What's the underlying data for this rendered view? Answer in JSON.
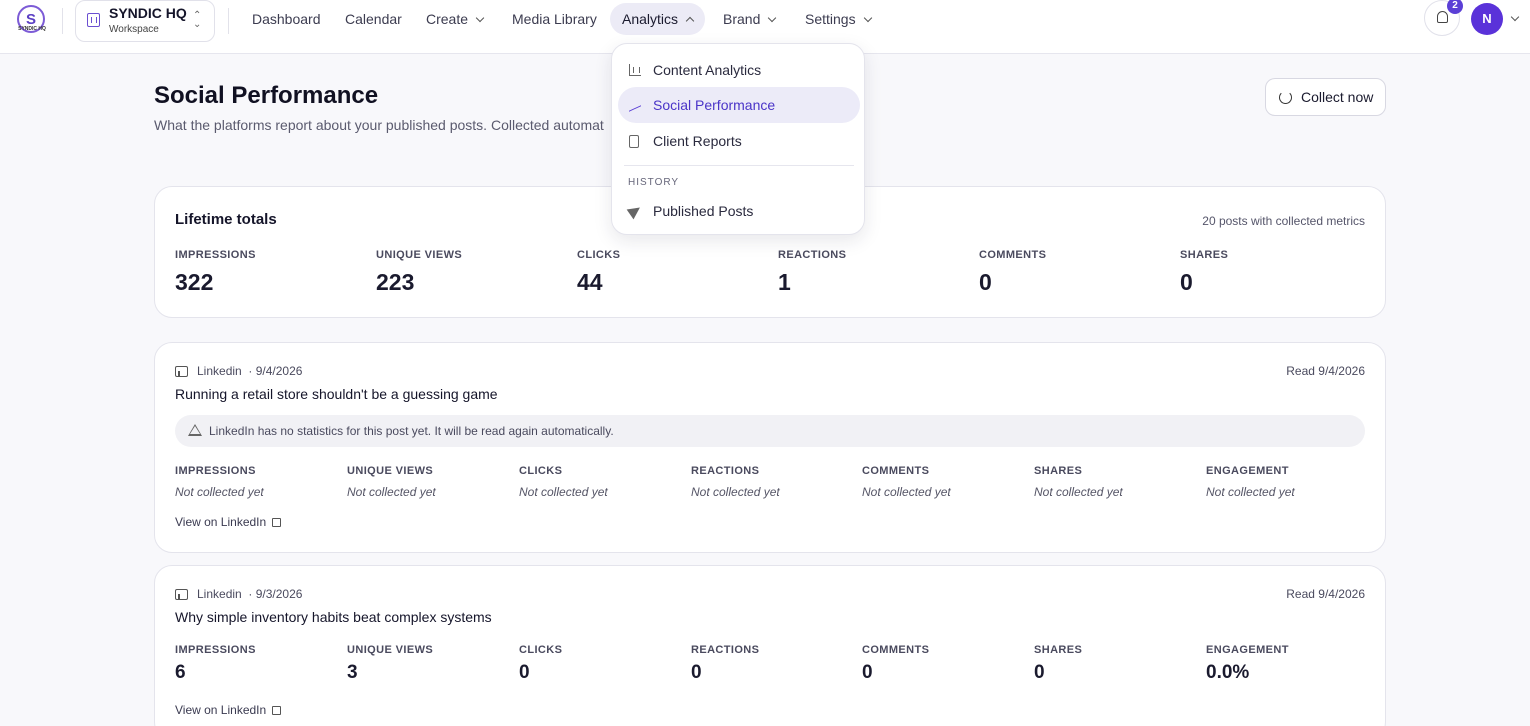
{
  "logo": {
    "mark": "S",
    "text": "SYNDIC HQ"
  },
  "workspace": {
    "name": "SYNDIC HQ",
    "sub": "Workspace"
  },
  "nav": {
    "dashboard": "Dashboard",
    "calendar": "Calendar",
    "create": "Create",
    "media": "Media Library",
    "analytics": "Analytics",
    "brand": "Brand",
    "settings": "Settings"
  },
  "notifications": {
    "count": "2"
  },
  "user": {
    "initial": "N"
  },
  "page": {
    "title": "Social Performance",
    "subtitle": "What the platforms report about your published posts. Collected automat",
    "collect_label": "Collect now"
  },
  "analytics_menu": {
    "items": [
      "Content Analytics",
      "Social Performance",
      "Client Reports"
    ],
    "section": "HISTORY",
    "history_items": [
      "Published Posts"
    ]
  },
  "totals": {
    "title": "Lifetime totals",
    "meta": "20 posts with collected metrics",
    "metrics": [
      {
        "label": "Impressions",
        "value": "322"
      },
      {
        "label": "Unique views",
        "value": "223"
      },
      {
        "label": "Clicks",
        "value": "44"
      },
      {
        "label": "Reactions",
        "value": "1"
      },
      {
        "label": "Comments",
        "value": "0"
      },
      {
        "label": "Shares",
        "value": "0"
      }
    ]
  },
  "posts": [
    {
      "platform": "Linkedin",
      "date": "· 9/4/2026",
      "read": "Read 9/4/2026",
      "title": "Running a retail store shouldn't be a guessing game",
      "warning": "LinkedIn has no statistics for this post yet. It will be read again automatically.",
      "link": "View on LinkedIn",
      "metrics": [
        {
          "label": "Impressions",
          "value": "Not collected yet"
        },
        {
          "label": "Unique views",
          "value": "Not collected yet"
        },
        {
          "label": "Clicks",
          "value": "Not collected yet"
        },
        {
          "label": "Reactions",
          "value": "Not collected yet"
        },
        {
          "label": "Comments",
          "value": "Not collected yet"
        },
        {
          "label": "Shares",
          "value": "Not collected yet"
        },
        {
          "label": "Engagement",
          "value": "Not collected yet"
        }
      ]
    },
    {
      "platform": "Linkedin",
      "date": "· 9/3/2026",
      "read": "Read 9/4/2026",
      "title": "Why simple inventory habits beat complex systems",
      "link": "View on LinkedIn",
      "metrics": [
        {
          "label": "Impressions",
          "value": "6"
        },
        {
          "label": "Unique views",
          "value": "3"
        },
        {
          "label": "Clicks",
          "value": "0"
        },
        {
          "label": "Reactions",
          "value": "0"
        },
        {
          "label": "Comments",
          "value": "0"
        },
        {
          "label": "Shares",
          "value": "0"
        },
        {
          "label": "Engagement",
          "value": "0.0%"
        }
      ]
    }
  ]
}
